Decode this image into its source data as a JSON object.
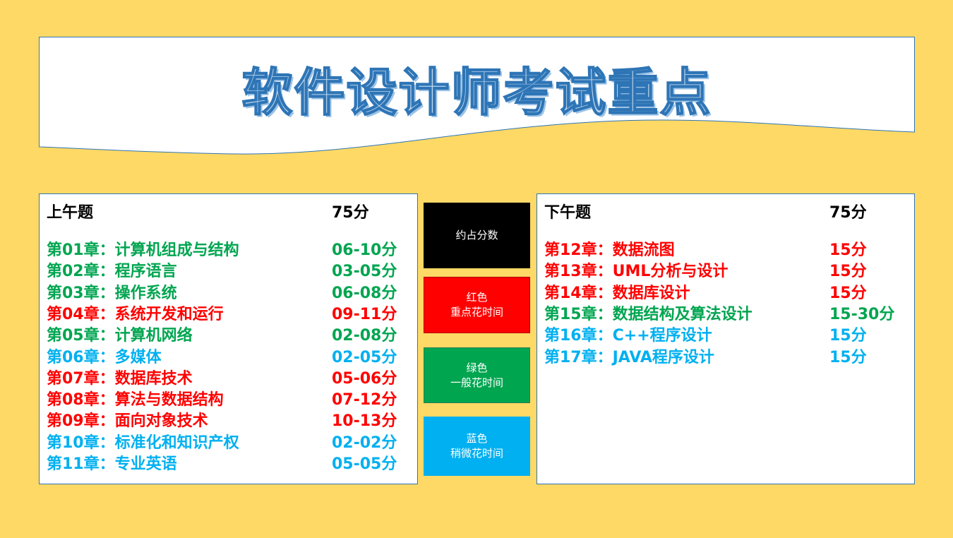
{
  "title": "软件设计师考试重点",
  "colors": {
    "red": "#ff0000",
    "green": "#00a550",
    "blue": "#00b0f0",
    "black": "#000000",
    "background": "#ffd966"
  },
  "morning": {
    "header": "上午题",
    "total": "75分",
    "chapters": [
      {
        "name": "第01章：计算机组成与结构",
        "score": "06-10分",
        "color": "green"
      },
      {
        "name": "第02章：程序语言",
        "score": "03-05分",
        "color": "green"
      },
      {
        "name": "第03章：操作系统",
        "score": "06-08分",
        "color": "green"
      },
      {
        "name": "第04章：系统开发和运行",
        "score": "09-11分",
        "color": "red"
      },
      {
        "name": "第05章：计算机网络",
        "score": "02-08分",
        "color": "green"
      },
      {
        "name": "第06章：多媒体",
        "score": "02-05分",
        "color": "blue"
      },
      {
        "name": "第07章：数据库技术",
        "score": "05-06分",
        "color": "red"
      },
      {
        "name": "第08章：算法与数据结构",
        "score": "07-12分",
        "color": "red"
      },
      {
        "name": "第09章：面向对象技术",
        "score": "10-13分",
        "color": "red"
      },
      {
        "name": "第10章：标准化和知识产权",
        "score": "02-02分",
        "color": "blue"
      },
      {
        "name": "第11章：专业英语",
        "score": "05-05分",
        "color": "blue"
      }
    ]
  },
  "afternoon": {
    "header": "下午题",
    "total": "75分",
    "chapters": [
      {
        "name": "第12章：数据流图",
        "score": "15分",
        "color": "red"
      },
      {
        "name": "第13章：UML分析与设计",
        "score": "15分",
        "color": "red"
      },
      {
        "name": "第14章：数据库设计",
        "score": "15分",
        "color": "red"
      },
      {
        "name": "第15章：数据结构及算法设计",
        "score": "15-30分",
        "color": "green"
      },
      {
        "name": "第16章：C++程序设计",
        "score": "15分",
        "color": "blue"
      },
      {
        "name": "第17章：JAVA程序设计",
        "score": "15分",
        "color": "blue"
      }
    ]
  },
  "legend": [
    {
      "lines": [
        "约占分数"
      ],
      "color": "black"
    },
    {
      "lines": [
        "红色",
        "重点花时间"
      ],
      "color": "red"
    },
    {
      "lines": [
        "绿色",
        "一般花时间"
      ],
      "color": "green"
    },
    {
      "lines": [
        "蓝色",
        "稍微花时间"
      ],
      "color": "blue"
    }
  ]
}
